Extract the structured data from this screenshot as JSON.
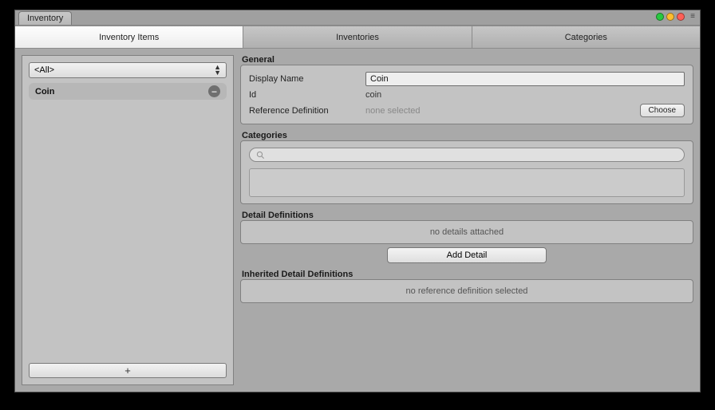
{
  "window": {
    "tab_label": "Inventory"
  },
  "main_tabs": {
    "items": "Inventory Items",
    "inventories": "Inventories",
    "categories": "Categories"
  },
  "left": {
    "filter_label": "<All>",
    "list_item": "Coin",
    "add_label": "+"
  },
  "right": {
    "general": {
      "title": "General",
      "display_name_label": "Display Name",
      "display_name_value": "Coin",
      "id_label": "Id",
      "id_value": "coin",
      "refdef_label": "Reference Definition",
      "refdef_value": "none selected",
      "choose_label": "Choose"
    },
    "categories": {
      "title": "Categories",
      "search_placeholder": ""
    },
    "details": {
      "title": "Detail Definitions",
      "empty_text": "no details attached",
      "add_label": "Add Detail"
    },
    "inherited": {
      "title": "Inherited Detail Definitions",
      "empty_text": "no reference definition selected"
    }
  }
}
